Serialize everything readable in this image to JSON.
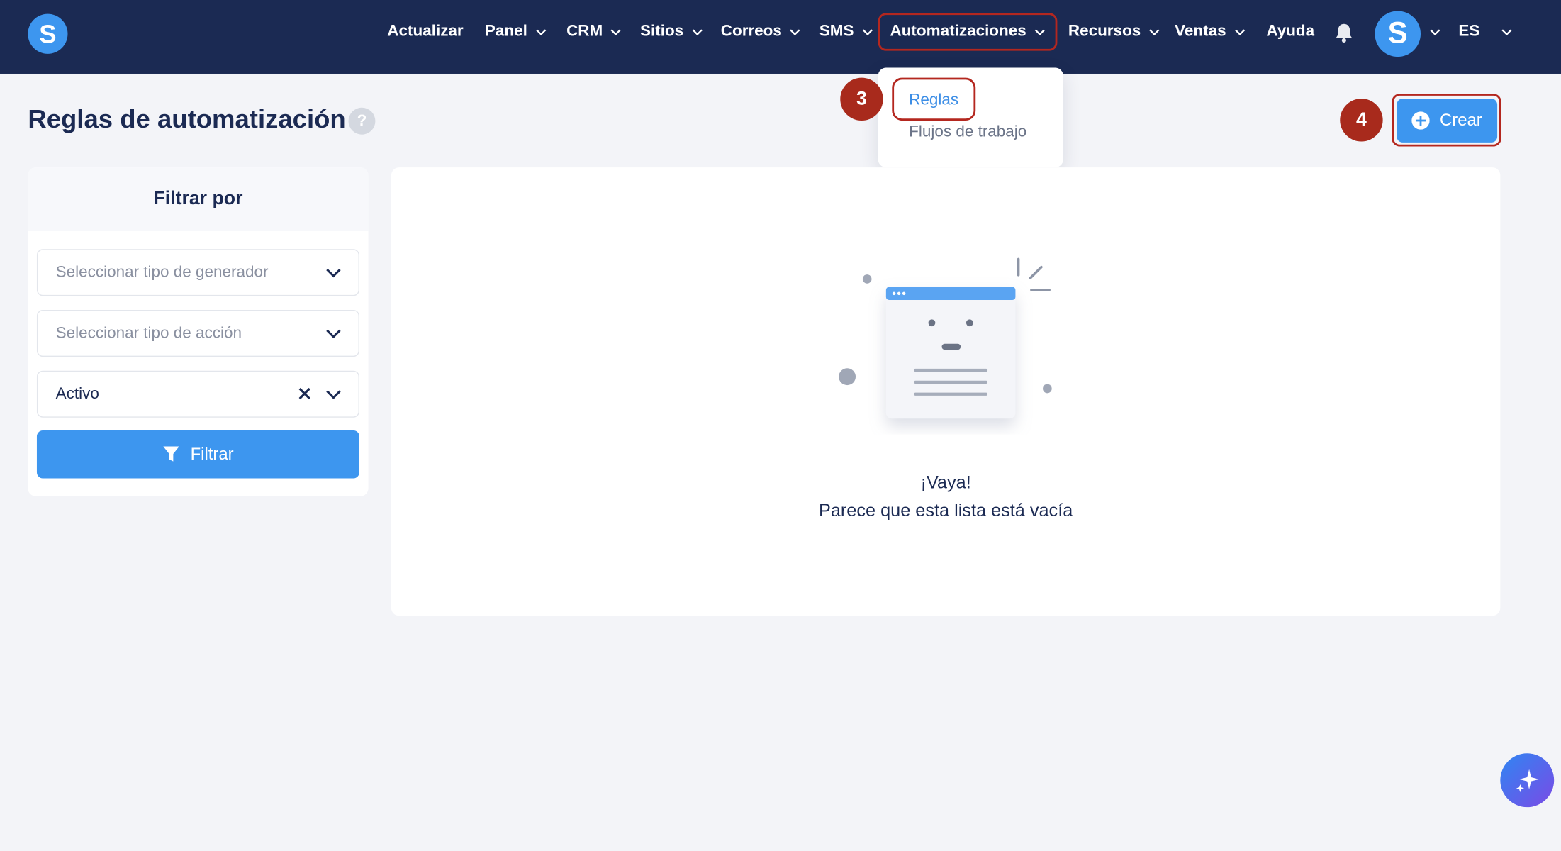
{
  "app": {
    "logo_letter": "S",
    "brand_color": "#3d96ef",
    "nav_bg_color": "#1b2a53",
    "highlight_color": "#b4271f"
  },
  "nav": {
    "items": [
      {
        "label": "Actualizar",
        "has_chevron": false
      },
      {
        "label": "Panel",
        "has_chevron": true
      },
      {
        "label": "CRM",
        "has_chevron": true
      },
      {
        "label": "Sitios",
        "has_chevron": true
      },
      {
        "label": "Correos",
        "has_chevron": true
      },
      {
        "label": "SMS",
        "has_chevron": true
      },
      {
        "label": "Automatizaciones",
        "has_chevron": true,
        "highlighted": true
      },
      {
        "label": "Recursos",
        "has_chevron": true
      },
      {
        "label": "Ventas",
        "has_chevron": true
      },
      {
        "label": "Ayuda",
        "has_chevron": false
      }
    ],
    "bell_icon": "bell-icon",
    "avatar_letter": "S",
    "language": "ES"
  },
  "dropdown": {
    "items": [
      {
        "label": "Reglas",
        "active": true
      },
      {
        "label": "Flujos de trabajo",
        "active": false
      }
    ]
  },
  "steps": {
    "dropdown_step": "3",
    "create_step": "4"
  },
  "page": {
    "title": "Reglas de automatización",
    "help_symbol": "?",
    "create_label": "Crear"
  },
  "filter": {
    "title": "Filtrar por",
    "generator_placeholder": "Seleccionar tipo de generador",
    "action_placeholder": "Seleccionar tipo de acción",
    "status_value": "Activo",
    "button_label": "Filtrar"
  },
  "empty_state": {
    "title": "¡Vaya!",
    "message": "Parece que esta lista está vacía"
  }
}
